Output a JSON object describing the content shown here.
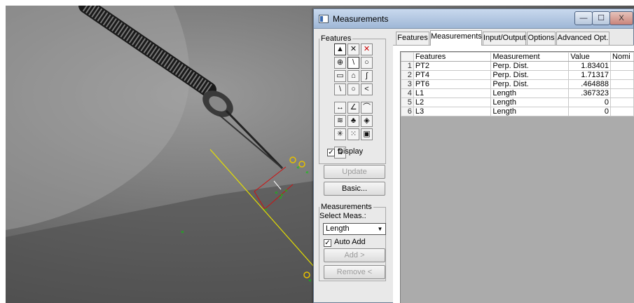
{
  "window": {
    "title": "Measurements",
    "controls": {
      "minimize": "—",
      "maximize": "☐",
      "close": "X"
    }
  },
  "features_panel": {
    "legend": "Features",
    "tools": [
      {
        "name": "pointer-tool-icon",
        "glyph": "▲"
      },
      {
        "name": "delete-feature-icon",
        "glyph": "✕"
      },
      {
        "name": "close-feature-icon",
        "glyph": "✕"
      },
      {
        "name": "point-tool-icon",
        "glyph": "⊕"
      },
      {
        "name": "line-tool-icon",
        "glyph": "\\"
      },
      {
        "name": "circle-tool-icon",
        "glyph": "○"
      },
      {
        "name": "rectangle-tool-icon",
        "glyph": "▭"
      },
      {
        "name": "polygon-tool-icon",
        "glyph": "⌂"
      },
      {
        "name": "curve-tool-icon",
        "glyph": "∫"
      },
      {
        "name": "fit-line-tool-icon",
        "glyph": "\\"
      },
      {
        "name": "fit-circle-tool-icon",
        "glyph": "○"
      },
      {
        "name": "angle-tool-icon",
        "glyph": "<"
      },
      {
        "name": "distance-tool-icon",
        "glyph": "↔"
      },
      {
        "name": "angle-measure-tool-icon",
        "glyph": "∠"
      },
      {
        "name": "arc-tool-icon",
        "glyph": "⌒"
      },
      {
        "name": "edge-tool-icon",
        "glyph": "≋"
      },
      {
        "name": "blob-tool-icon",
        "glyph": "♣"
      },
      {
        "name": "edge-point-tool-icon",
        "glyph": "◈"
      },
      {
        "name": "spark-tool-icon",
        "glyph": "✳"
      },
      {
        "name": "points-tool-icon",
        "glyph": "⁙"
      },
      {
        "name": "image-tool-icon",
        "glyph": "▣"
      },
      {
        "name": "sort-tool-icon",
        "glyph": "⇅"
      }
    ],
    "display_label": "Display",
    "display_checked": true,
    "update_label": "Update",
    "basic_label": "Basic..."
  },
  "measurements_panel": {
    "legend": "Measurements",
    "select_label": "Select Meas.:",
    "select_value": "Length",
    "auto_add_label": "Auto Add",
    "auto_add_checked": true,
    "add_label": "Add >",
    "remove_label": "Remove <"
  },
  "tabs": [
    {
      "label": "Features",
      "active": false
    },
    {
      "label": "Measurements",
      "active": true
    },
    {
      "label": "Input/Output",
      "active": false
    },
    {
      "label": "Options",
      "active": false
    },
    {
      "label": "Advanced Opt.",
      "active": false
    }
  ],
  "table": {
    "columns": [
      "Features",
      "Measurement",
      "Value",
      "Nomi"
    ],
    "rows": [
      {
        "index": "1",
        "feature": "PT2",
        "measurement": "Perp. Dist.",
        "value": "1.83401"
      },
      {
        "index": "2",
        "feature": "PT4",
        "measurement": "Perp. Dist.",
        "value": "1.71317"
      },
      {
        "index": "3",
        "feature": "PT6",
        "measurement": "Perp. Dist.",
        "value": ".464888"
      },
      {
        "index": "4",
        "feature": "L1",
        "measurement": "Length",
        "value": ".367323"
      },
      {
        "index": "5",
        "feature": "L2",
        "measurement": "Length",
        "value": "0"
      },
      {
        "index": "6",
        "feature": "L3",
        "measurement": "Length",
        "value": "0"
      }
    ]
  },
  "overlay": {
    "line_color": "#e6e000",
    "marker_color": "#00d400",
    "measure_color": "#d01010",
    "marker_glyph": "«"
  }
}
